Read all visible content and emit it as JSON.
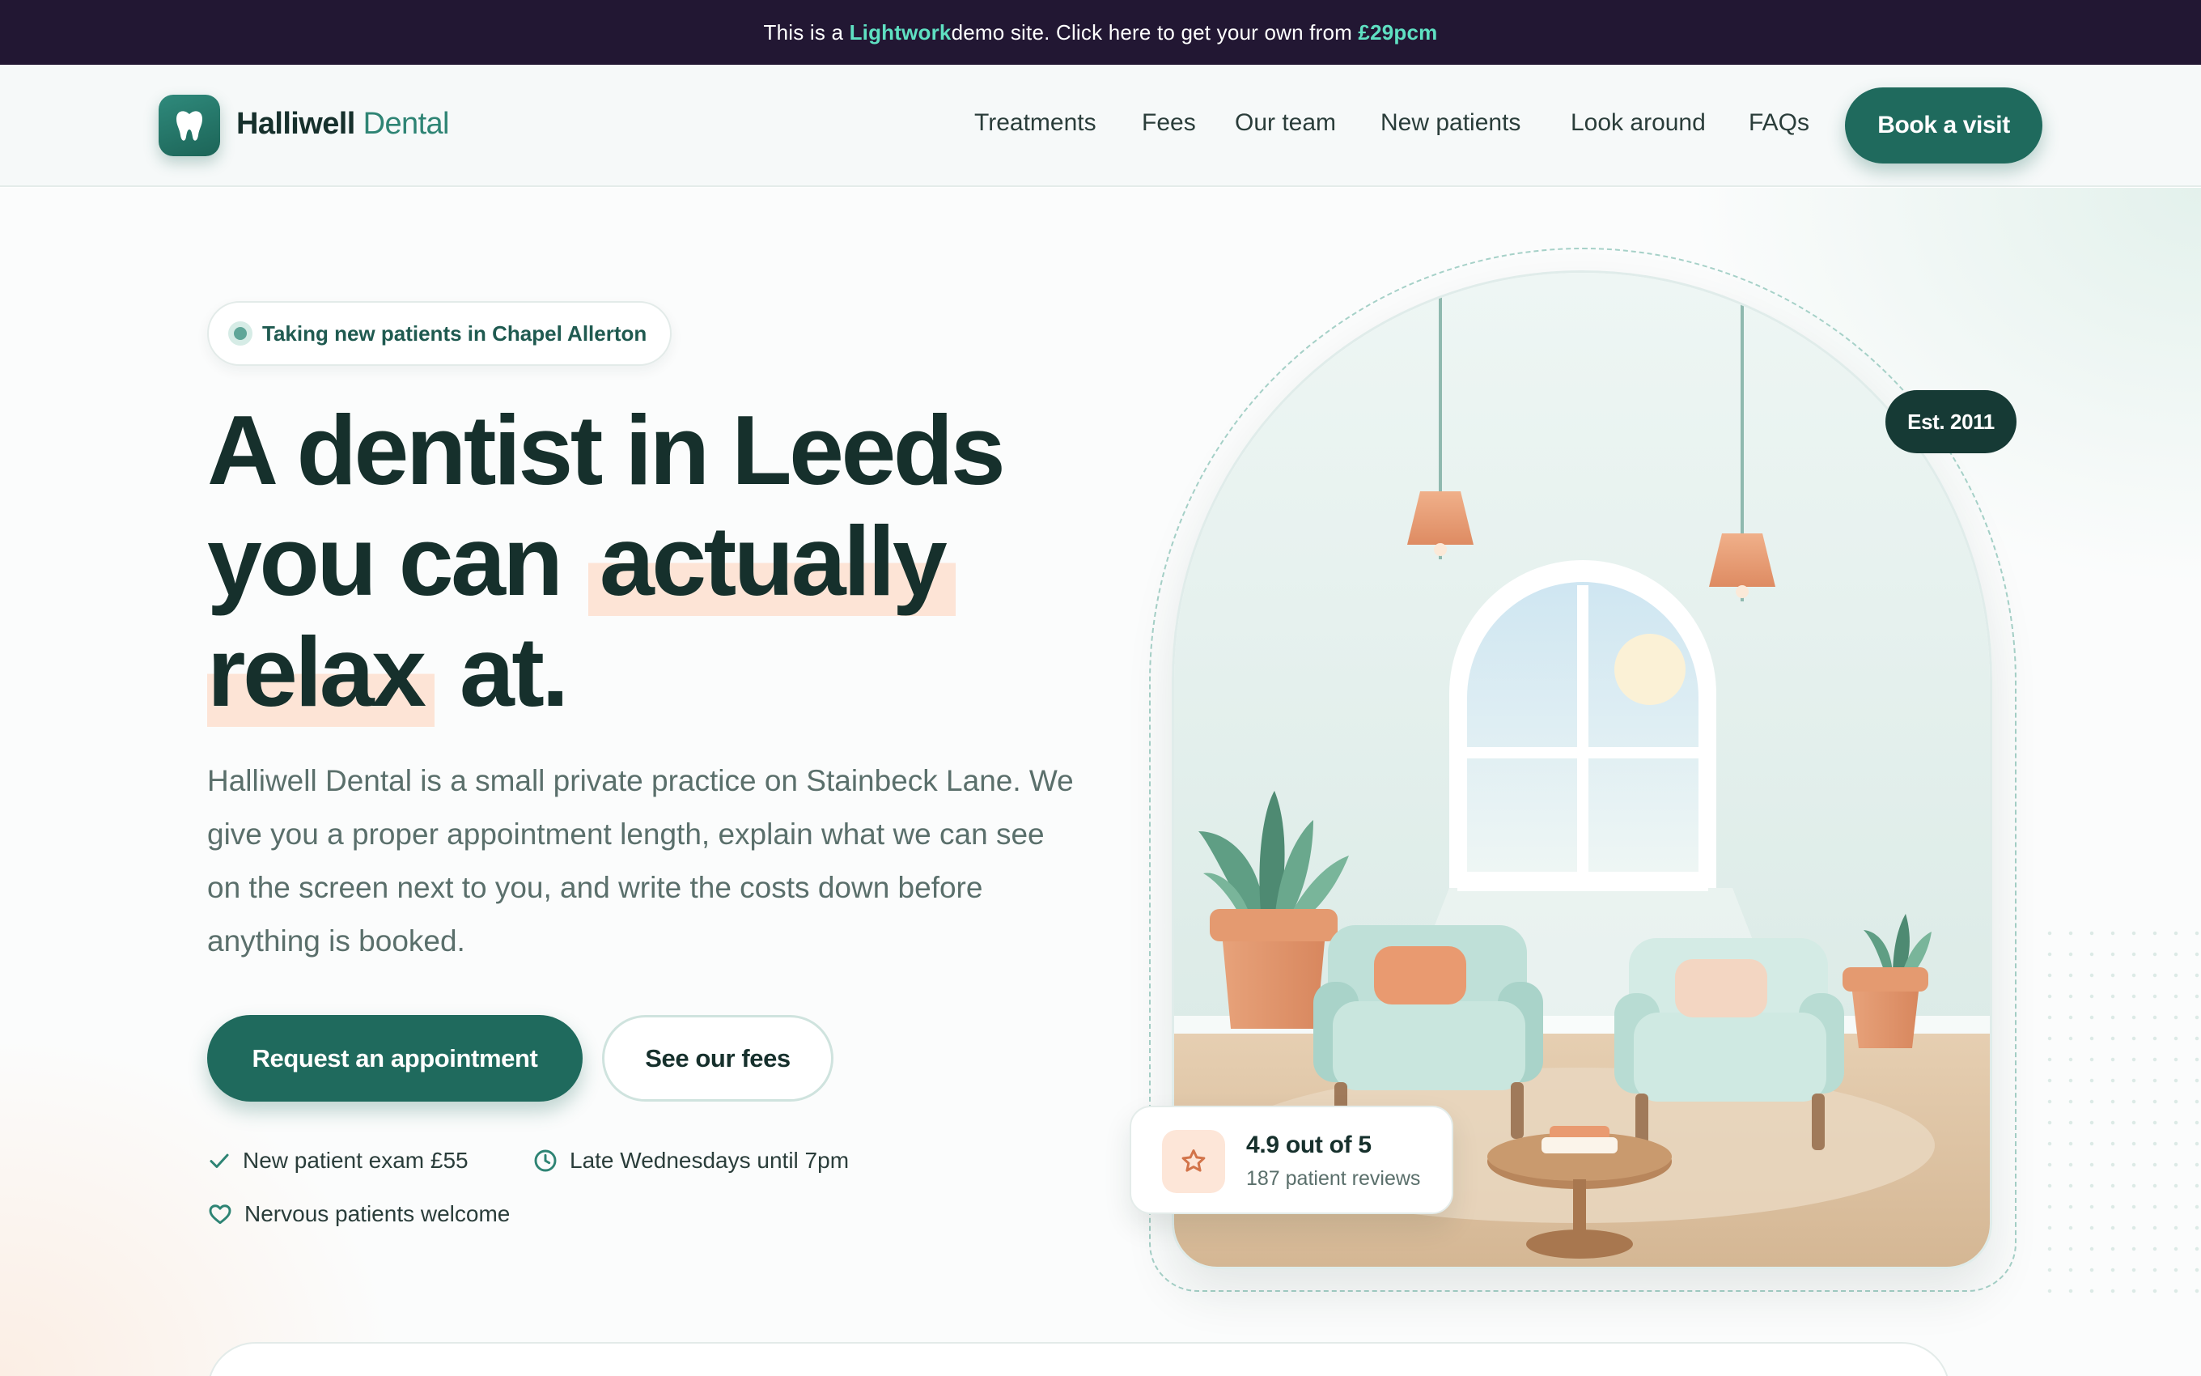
{
  "promo": {
    "prefix": "This is a ",
    "brand": "Lightwork",
    "middle": " demo site. Click here to get your own from ",
    "price": "£29pcm"
  },
  "nav": {
    "brand_first": "Halliwell",
    "brand_second": "Dental",
    "links": [
      "Treatments",
      "Fees",
      "Our team",
      "New patients",
      "Look around",
      "FAQs"
    ],
    "cta": "Book a visit"
  },
  "hero": {
    "badge": "Taking new patients in Chapel Allerton",
    "heading": {
      "line1": "A dentist in Leeds",
      "line2_a": "you can",
      "line2_highlight": "actually",
      "line3_highlight": "relax",
      "line3_b": "at."
    },
    "lead": "Halliwell Dental is a small private practice on Stainbeck Lane. We give you a proper appointment length, explain what we can see on the screen next to you, and write the costs down before anything is booked.",
    "primary_cta": "Request an appointment",
    "secondary_cta": "See our fees",
    "features": [
      {
        "icon": "check-icon",
        "label": "New patient exam £55"
      },
      {
        "icon": "clock-icon",
        "label": "Late Wednesdays until 7pm"
      },
      {
        "icon": "heart-icon",
        "label": "Nervous patients welcome"
      }
    ]
  },
  "illustration": {
    "est_badge": "Est. 2011",
    "rating": {
      "title": "4.9 out of 5",
      "subtitle": "187 patient reviews",
      "icon": "star-icon"
    }
  },
  "colors": {
    "accent": "#1f6a5d",
    "promo_bg": "#221733",
    "promo_highlight": "#5fe0c2",
    "highlight_mark": "#fde4d6",
    "heading": "#16302c"
  }
}
